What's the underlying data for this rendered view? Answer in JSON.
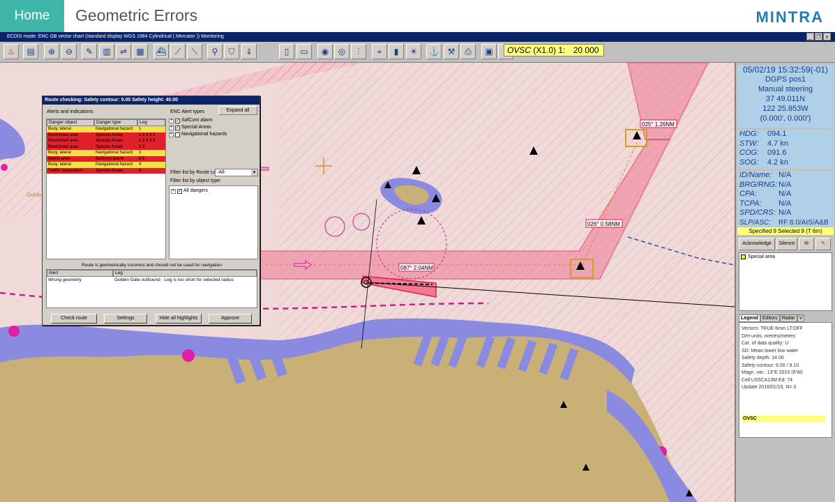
{
  "header": {
    "home_label": "Home",
    "title": "Geometric Errors",
    "brand": "MINTRA"
  },
  "window": {
    "title": "ECDIS mode: ENC GB vector chart (standard display  WGS 1984  Cylindrical ( Mercator ))     Monitoring",
    "min": "_",
    "restore": "❐",
    "close": "x"
  },
  "toolbar": {
    "ovsc_label": "OVSC",
    "ovsc_scale": "(X1.0) 1:",
    "ovsc_value": "20 000"
  },
  "status": {
    "datetime": "05/02/19 15:32:59(-01)",
    "position_source": "DGPS pos1",
    "steering": "Manual steering",
    "lat": "37 49.011N",
    "lon": "122 25.853W",
    "offset": "(0.000', 0.000')",
    "nav": [
      {
        "k": "HDG:",
        "v": "094.1"
      },
      {
        "k": "STW:",
        "v": "4.7 kn"
      },
      {
        "k": "COG:",
        "v": "091.6"
      },
      {
        "k": "SOG:",
        "v": "4.2 kn"
      }
    ],
    "target": [
      {
        "k": "ID/Name:",
        "v": "N/A"
      },
      {
        "k": "BRG/RNG:",
        "v": "N/A"
      },
      {
        "k": "CPA:",
        "v": "N/A"
      },
      {
        "k": "TCPA:",
        "v": "N/A"
      },
      {
        "k": "SPD/CRS:",
        "v": "N/A"
      },
      {
        "k": "SLP/ASC:",
        "v": "RF:6.0/AIS/A&B"
      }
    ],
    "specified": "Specified 9 Selected 9 (T  6m)"
  },
  "alerts_panel": {
    "acknowledge": "Acknowledge",
    "silence": "Silence",
    "items": [
      "Special area"
    ]
  },
  "legend": {
    "tabs": [
      "Legend",
      "Editors",
      "Radar",
      "V"
    ],
    "lines": [
      "Vectors: TRUE  6min LT:OFF",
      "D/H units: metres/metres",
      "Cat. of data quality: U",
      "SD: Mean lower low water",
      "Safety depth: 14.00",
      "Safety contour: 9.00 / 9.10",
      "Magn. var.: 13°E 2015 (6'W)",
      "Cell:US5CA13M Ed: 74",
      "Update:2016/01/15, N= 0"
    ],
    "ovsc": "OVSC"
  },
  "chart": {
    "labels": [
      "025° 1.26NM",
      "026° 0.58NM",
      "087° 2.04NM",
      "Golden"
    ]
  },
  "dialog": {
    "title": "Route checking:  Safety contour: 9.00  Safety height: 40.00",
    "alerts_label": "Alerts and indications",
    "columns": [
      "Danger object",
      "Danger type",
      "Leg"
    ],
    "rows": [
      {
        "obj": "Buoy, lateral",
        "type": "Navigational hazard",
        "leg": "1",
        "sev": "warn"
      },
      {
        "obj": "Restricted area",
        "type": "Special Areas",
        "leg": "1 2 3 4 5",
        "sev": "alarm"
      },
      {
        "obj": "Restricted area",
        "type": "Special Areas",
        "leg": "1 2 3 4 5",
        "sev": "alarm"
      },
      {
        "obj": "Restricted area",
        "type": "Special Areas",
        "leg": "2 3",
        "sev": "alarm"
      },
      {
        "obj": "Buoy, lateral",
        "type": "Navigational hazard",
        "leg": "3",
        "sev": "warn"
      },
      {
        "obj": "Depth area",
        "type": "SafCont alarm",
        "leg": "5 6",
        "sev": "alarm"
      },
      {
        "obj": "Buoy, lateral",
        "type": "Navigational hazard",
        "leg": "4",
        "sev": "warn"
      },
      {
        "obj": "Traffic separation",
        "type": "Special Areas",
        "leg": "6",
        "sev": "alarm"
      }
    ],
    "enc_label": "ENC Alert types",
    "expand_all": "Expand all",
    "alert_types": [
      {
        "label": "SafCont alarm",
        "checked": true
      },
      {
        "label": "Special Areas",
        "checked": true
      },
      {
        "label": "Navigational hazards",
        "checked": false
      }
    ],
    "filter_leg_label": "Filter list by Route Leg",
    "filter_leg_value": "-All-",
    "filter_obj_label": "Filter list by object type:",
    "all_dangers": "All dangers",
    "message": "Route is geometrically incorrect and should not be used for navigation",
    "alert_cols": [
      "Alert",
      "Leg"
    ],
    "alert_rows": [
      {
        "alert": "Wrong geometry",
        "leg": "Golden Gate outbound - Leg is too short for selected radius"
      }
    ],
    "buttons": {
      "check_route": "Check route",
      "settings": "Settings",
      "hide_highlights": "Hide all highlights",
      "approve": "Approve"
    }
  }
}
